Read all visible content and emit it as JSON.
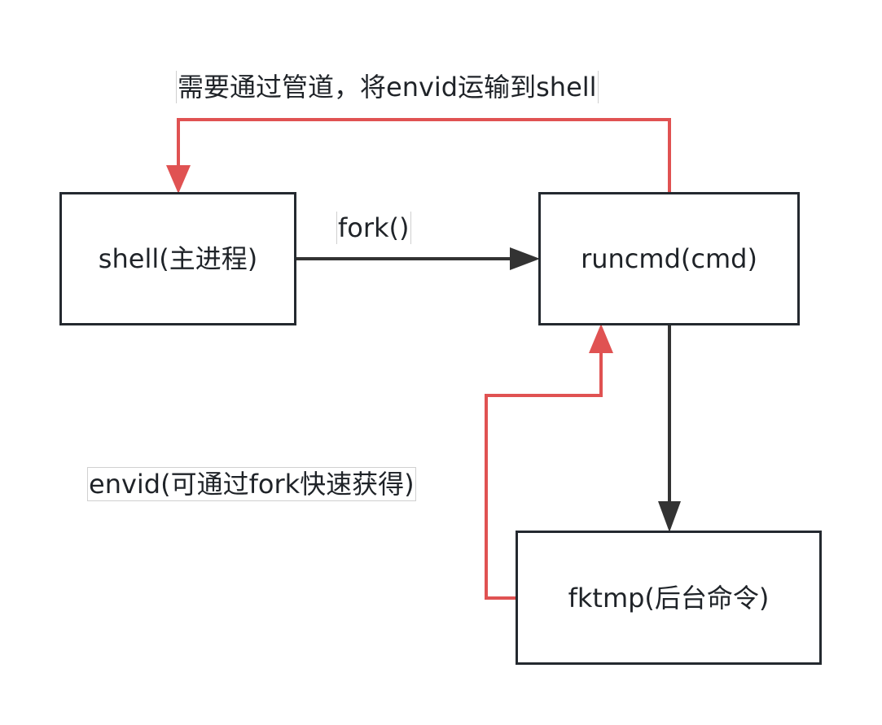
{
  "nodes": {
    "shell": "shell(主进程)",
    "runcmd": "runcmd(cmd)",
    "fktmp": "fktmp(后台命令)"
  },
  "edges": {
    "pipe_label": "需要通过管道，将envid运输到shell",
    "fork_label": "fork()",
    "envid_label": "envid(可通过fork快速获得)"
  },
  "colors": {
    "node_border": "#24292f",
    "black_arrow": "#333333",
    "red_arrow": "#e05252"
  }
}
